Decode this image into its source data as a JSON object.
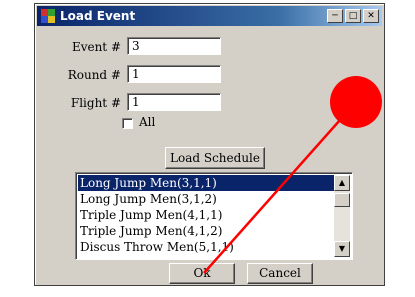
{
  "window": {
    "title": "Load Event"
  },
  "fields": {
    "event": {
      "label": "Event #",
      "value": "3"
    },
    "round": {
      "label": "Round #",
      "value": "1"
    },
    "flight": {
      "label": "Flight #",
      "value": "1"
    }
  },
  "all_checkbox": {
    "label": "All",
    "checked": false
  },
  "load_schedule_label": "Load Schedule",
  "event_list": {
    "items": [
      "Long Jump Men(3,1,1)",
      "Long Jump Men(3,1,2)",
      "Triple Jump Men(4,1,1)",
      "Triple Jump Men(4,1,2)",
      "Discus Throw Men(5,1,1)"
    ],
    "selected_index": 0
  },
  "buttons": {
    "ok": "Ok",
    "cancel": "Cancel"
  },
  "annotation": {
    "dot_color": "#ff0000",
    "line_color": "#ff0000"
  }
}
